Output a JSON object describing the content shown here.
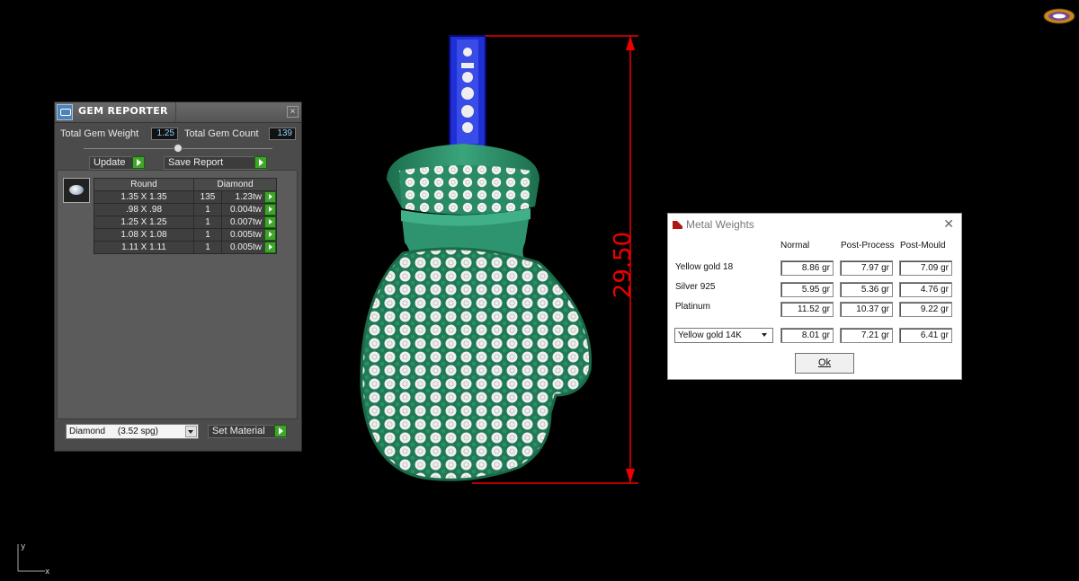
{
  "gem_reporter": {
    "title": "GEM REPORTER",
    "total_weight_label": "Total Gem Weight",
    "total_weight_value": "1.25",
    "total_count_label": "Total Gem Count",
    "total_count_value": "139",
    "update_label": "Update",
    "save_report_label": "Save Report",
    "table_headers": [
      "Round",
      "Diamond"
    ],
    "rows": [
      {
        "size": "1.35 X 1.35",
        "count": "135",
        "weight": "1.23tw"
      },
      {
        "size": ".98 X .98",
        "count": "1",
        "weight": "0.004tw"
      },
      {
        "size": "1.25 X 1.25",
        "count": "1",
        "weight": "0.007tw"
      },
      {
        "size": "1.08 X 1.08",
        "count": "1",
        "weight": "0.005tw"
      },
      {
        "size": "1.11 X 1.11",
        "count": "1",
        "weight": "0.005tw"
      }
    ],
    "material_select": "Diamond     (3.52 spg)",
    "set_material_label": "Set Material"
  },
  "viewport": {
    "dimension_label": "29.50",
    "axis_y": "y",
    "axis_x": "x"
  },
  "metal_weights": {
    "title": "Metal Weights",
    "columns": [
      "Normal",
      "Post-Process",
      "Post-Mould"
    ],
    "rows": [
      {
        "label": "Yellow gold 18",
        "values": [
          "8.86 gr",
          "7.97 gr",
          "7.09 gr"
        ]
      },
      {
        "label": "Silver 925",
        "values": [
          "5.95 gr",
          "5.36 gr",
          "4.76 gr"
        ]
      },
      {
        "label": "Platinum",
        "values": [
          "11.52 gr",
          "10.37 gr",
          "9.22 gr"
        ]
      }
    ],
    "custom_select": "Yellow gold 14K",
    "custom_values": [
      "8.01 gr",
      "7.21 gr",
      "6.41 gr"
    ],
    "ok_label": "Ok"
  },
  "colors": {
    "mitten_green": "#2a8a64",
    "stone_white": "#f2f2f2",
    "bail_blue": "#2030d0",
    "dimension_red": "#e00000"
  }
}
